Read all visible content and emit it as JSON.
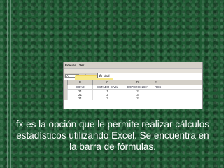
{
  "screenshot": {
    "menu": [
      "Edición",
      "Ver"
    ],
    "name_box": "A",
    "fx_label": "fx",
    "formula_value": "dad",
    "toolbar2_labels": [
      "Insé",
      "ede"
    ],
    "column_letters": [
      "",
      "B",
      "C",
      "D",
      "E"
    ],
    "headers": [
      "EDAD",
      "ESTADO CIVIL",
      "EXPERIENCIA",
      "RES"
    ],
    "rows": [
      [
        "21",
        "1",
        "2"
      ],
      [
        "21",
        "2",
        "3"
      ],
      [
        "21",
        "3",
        "2"
      ]
    ]
  },
  "caption": "fx es la opción que le permite realizar cálculos estadísticos utilizando Excel.  Se encuentra en la barra de fórmulas.",
  "colors": {
    "background": "#1f5a33",
    "highlight": "#f7e98a",
    "text": "#ffffff"
  }
}
